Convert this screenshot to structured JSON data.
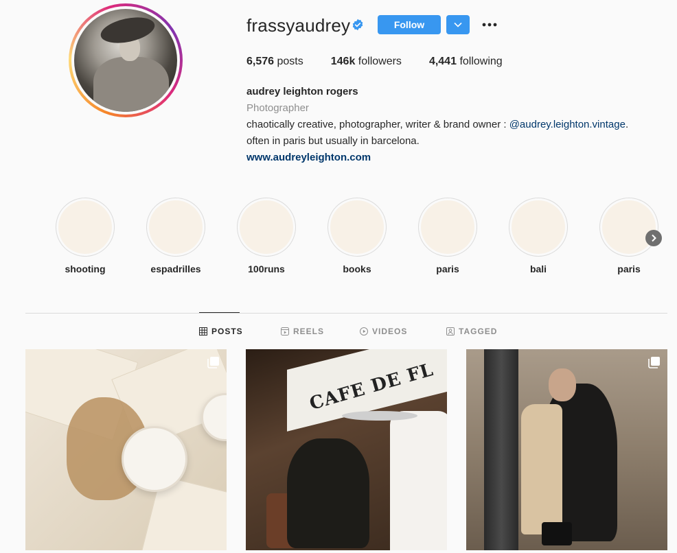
{
  "profile": {
    "username": "frassyaudrey",
    "verified": true,
    "follow_label": "Follow",
    "stats": {
      "posts_value": "6,576",
      "posts_label": "posts",
      "followers_value": "146k",
      "followers_label": "followers",
      "following_value": "4,441",
      "following_label": "following"
    },
    "bio": {
      "full_name": "audrey leighton rogers",
      "category": "Photographer",
      "line1_text": "chaotically creative, photographer, writer & brand owner : ",
      "line1_mention": "@audrey.leighton.vintage",
      "line1_end": ".",
      "line2": "often in paris but usually in barcelona.",
      "website": "www.audreyleighton.com"
    }
  },
  "highlights": [
    {
      "label": "shooting"
    },
    {
      "label": "espadrilles"
    },
    {
      "label": "100runs"
    },
    {
      "label": "books"
    },
    {
      "label": "paris"
    },
    {
      "label": "bali"
    },
    {
      "label": "paris"
    }
  ],
  "tabs": [
    {
      "label": "POSTS",
      "icon": "grid-icon",
      "active": true
    },
    {
      "label": "REELS",
      "icon": "reels-icon",
      "active": false
    },
    {
      "label": "VIDEOS",
      "icon": "video-icon",
      "active": false
    },
    {
      "label": "TAGGED",
      "icon": "tagged-icon",
      "active": false
    }
  ],
  "posts": {
    "post2_sign_text": "CAFE DE FL"
  },
  "colors": {
    "accent": "#3897f0",
    "link": "#00376b",
    "text": "#262626",
    "muted": "#8e8e8e"
  }
}
